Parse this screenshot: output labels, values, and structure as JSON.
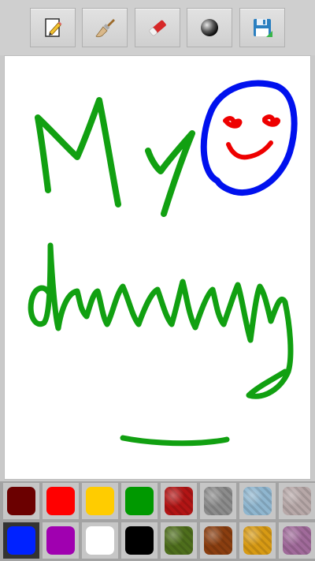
{
  "toolbar": {
    "tools": [
      {
        "icon": "new-document-pencil-icon"
      },
      {
        "icon": "brush-icon"
      },
      {
        "icon": "eraser-icon"
      },
      {
        "icon": "brush-size-circle-icon"
      },
      {
        "icon": "save-floppy-icon"
      }
    ]
  },
  "palette": {
    "selected_index": 8,
    "swatches": [
      {
        "name": "dark-red",
        "color": "#6b0000"
      },
      {
        "name": "red",
        "color": "#ff0000"
      },
      {
        "name": "yellow",
        "color": "#ffcc00"
      },
      {
        "name": "green",
        "color": "#009900"
      },
      {
        "name": "red-texture",
        "color": "#b21515"
      },
      {
        "name": "stone-texture",
        "color": "#8c8c8c"
      },
      {
        "name": "sky-texture",
        "color": "#8fb6cf"
      },
      {
        "name": "marble-texture",
        "color": "#b7a8a8"
      },
      {
        "name": "blue",
        "color": "#0022ff"
      },
      {
        "name": "purple",
        "color": "#a000b0"
      },
      {
        "name": "white",
        "color": "#ffffff"
      },
      {
        "name": "black",
        "color": "#000000"
      },
      {
        "name": "leaf-texture",
        "color": "#4e6e1c"
      },
      {
        "name": "wood-texture",
        "color": "#8a3e10"
      },
      {
        "name": "gold-texture",
        "color": "#d79a14"
      },
      {
        "name": "purple-texture",
        "color": "#a06a9a"
      }
    ]
  },
  "drawing": {
    "stroke_colors": {
      "text": "#11a011",
      "circle": "#0011ee",
      "face": "#ee0000"
    }
  }
}
